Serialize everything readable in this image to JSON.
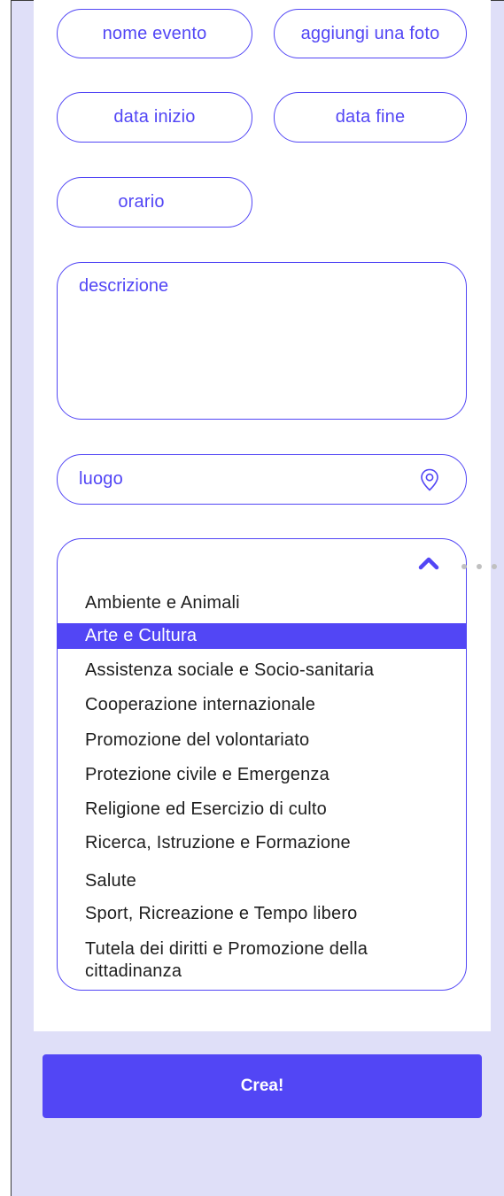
{
  "form": {
    "event_name": "nome evento",
    "add_photo": "aggiungi una foto",
    "start_date": "data inizio",
    "end_date": "data fine",
    "time": "orario",
    "description": "descrizione",
    "location": "luogo"
  },
  "category_dropdown": {
    "expanded": true,
    "selected": "Arte e Cultura",
    "options": [
      "Ambiente e Animali",
      "Arte e Cultura",
      "Assistenza sociale e Socio-sanitaria",
      "Cooperazione internazionale",
      "Promozione del volontariato",
      "Protezione civile e Emergenza",
      "Religione ed Esercizio di culto",
      "Ricerca, Istruzione e Formazione",
      "Salute",
      "Sport, Ricreazione e Tempo libero",
      "Tutela dei diritti e Promozione della cittadinanza"
    ]
  },
  "submit_label": "Crea!",
  "icons": {
    "location": "map-pin-icon",
    "collapse": "chevron-up-icon",
    "more": "more-dots-icon"
  },
  "colors": {
    "accent": "#5246f5",
    "background": "#dfdff8",
    "card": "#ffffff",
    "text": "#1e1e1e"
  }
}
